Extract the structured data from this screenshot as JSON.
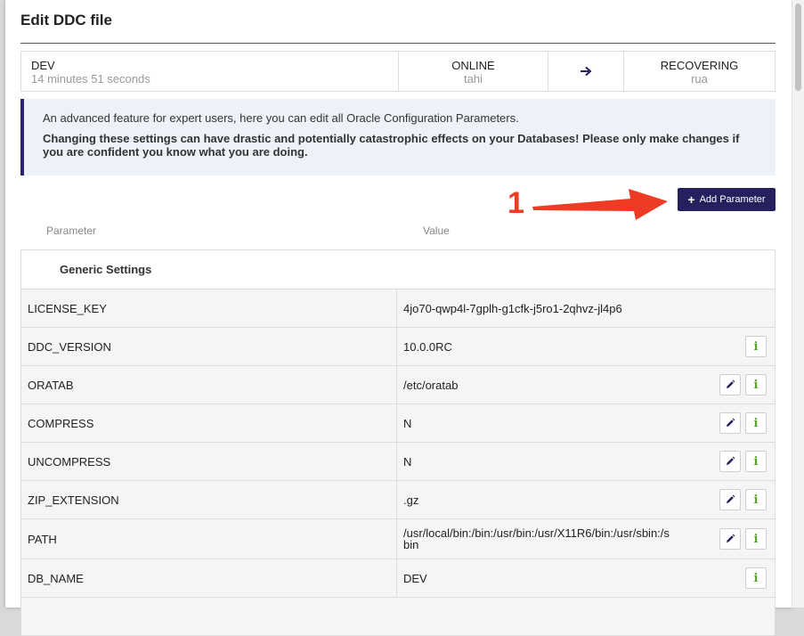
{
  "modal": {
    "title": "Edit DDC file"
  },
  "status": {
    "db_name": "DEV",
    "duration": "14 minutes 51 seconds",
    "current_state": "ONLINE",
    "current_host": "tahi",
    "target_state": "RECOVERING",
    "target_host": "rua"
  },
  "callout": {
    "info": "An advanced feature for expert users, here you can edit all Oracle Configuration Parameters.",
    "warning": "Changing these settings can have drastic and potentially catastrophic effects on your Databases! Please only make changes if you are confident you know what you are doing."
  },
  "toolbar": {
    "add_label": "Add Parameter"
  },
  "annotation": {
    "number": "1",
    "color": "#ee3b23"
  },
  "columns": {
    "parameter": "Parameter",
    "value": "Value"
  },
  "section": {
    "title": "Generic Settings"
  },
  "rows": [
    {
      "name": "LICENSE_KEY",
      "value": "4jo70-qwp4l-7gplh-g1cfk-j5ro1-2qhvz-jl4p6"
    },
    {
      "name": "DDC_VERSION",
      "value": "10.0.0RC"
    },
    {
      "name": "ORATAB",
      "value": "/etc/oratab"
    },
    {
      "name": "COMPRESS",
      "value": "N"
    },
    {
      "name": "UNCOMPRESS",
      "value": "N"
    },
    {
      "name": "ZIP_EXTENSION",
      "value": ".gz"
    },
    {
      "name": "PATH",
      "value": "/usr/local/bin:/bin:/usr/bin:/usr/X11R6/bin:/usr/sbin:/sbin"
    },
    {
      "name": "DB_NAME",
      "value": "DEV"
    }
  ],
  "colors": {
    "brand": "#27205f",
    "info_icon": "#5aa02c",
    "callout_bg": "#edf2f8"
  },
  "icons": {
    "edit": "pencil-icon",
    "info": "info-icon",
    "arrow": "arrow-right-icon",
    "add": "plus-icon"
  }
}
